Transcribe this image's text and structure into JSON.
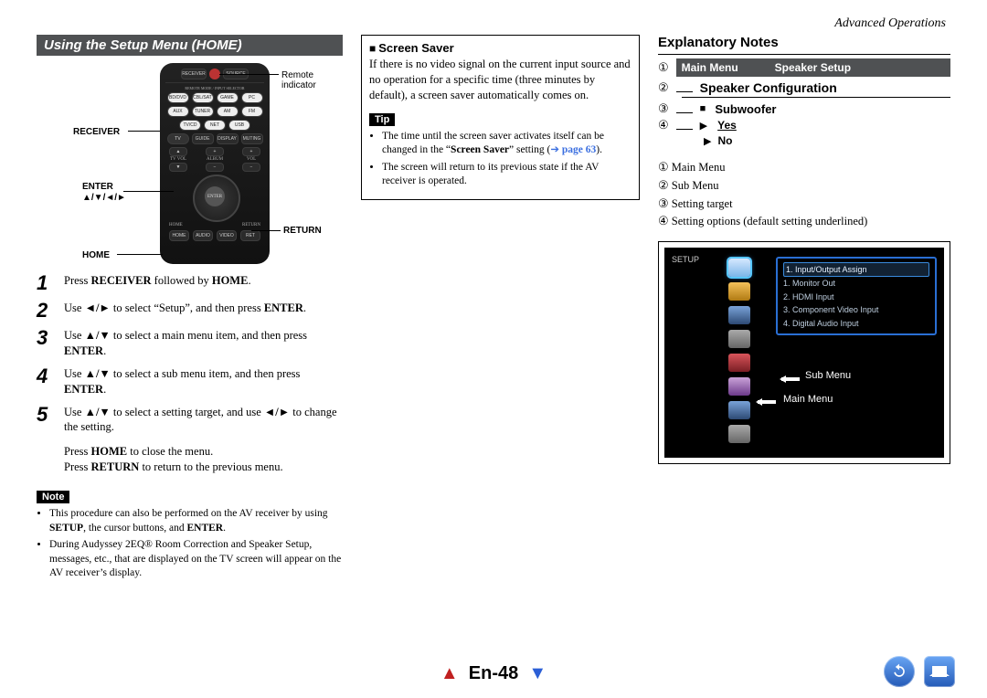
{
  "header": {
    "section": "Advanced Operations"
  },
  "col1": {
    "title": "Using the Setup Menu (HOME)",
    "remoteCallouts": {
      "indicator": "Remote indicator",
      "receiver": "RECEIVER",
      "enter": "ENTER",
      "arrows": "▲/▼/◄/►",
      "home": "HOME",
      "return": "RETURN"
    },
    "steps": [
      {
        "n": "1",
        "html": "Press <b>RECEIVER</b> followed by <b>HOME</b>."
      },
      {
        "n": "2",
        "html": "Use <b>◄/►</b> to select “Setup”, and then press <b>ENTER</b>."
      },
      {
        "n": "3",
        "html": "Use <b>▲/▼</b> to select a main menu item, and then press <b>ENTER</b>."
      },
      {
        "n": "4",
        "html": "Use <b>▲/▼</b> to select a sub menu item, and then press <b>ENTER</b>."
      },
      {
        "n": "5",
        "html": "Use <b>▲/▼</b> to select a setting target, and use <b>◄/►</b> to change the setting."
      }
    ],
    "afterSteps": [
      "Press <b>HOME</b> to close the menu.",
      "Press <b>RETURN</b> to return to the previous menu."
    ],
    "noteTag": "Note",
    "noteBullets": [
      "This procedure can also be performed on the AV receiver by using <b>SETUP</b>, the cursor buttons, and <b>ENTER</b>.",
      "During Audyssey 2EQ® Room Correction and Speaker Setup, messages, etc., that are displayed on the TV screen will appear on the AV receiver’s display."
    ]
  },
  "col2": {
    "heading": "Screen Saver",
    "body": "If there is no video signal on the current input source and no operation for a specific time (three minutes by default), a screen saver automatically comes on.",
    "tipTag": "Tip",
    "tipBullets": [
      "The time until the screen saver activates itself can be changed in the “<b>Screen Saver</b>” setting (<span class=\"link\">➔ <b>page 63</b></span>).",
      "The screen will return to its previous state if the AV receiver is operated."
    ]
  },
  "col3": {
    "title": "Explanatory Notes",
    "menuBar": {
      "left": "Main Menu",
      "right": "Speaker Setup"
    },
    "line2": "Speaker Configuration",
    "line3": "Subwoofer",
    "line4a": "Yes",
    "line4b": "No",
    "legend": [
      "Main Menu",
      "Sub Menu",
      "Setting target",
      "Setting options (default setting underlined)"
    ],
    "circled": [
      "①",
      "②",
      "③",
      "④"
    ],
    "osd": {
      "setup": "SETUP",
      "items": [
        "1. Input/Output Assign",
        "1. Monitor Out",
        "2. HDMI Input",
        "3. Component Video Input",
        "4. Digital Audio Input"
      ],
      "labelSub": "Sub Menu",
      "labelMain": "Main Menu"
    }
  },
  "footer": {
    "page": "En-48"
  }
}
